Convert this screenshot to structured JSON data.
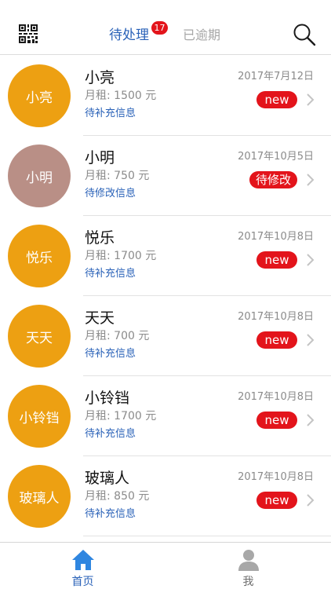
{
  "header": {
    "tabs": [
      {
        "label": "待处理",
        "badge": "17",
        "active": true
      },
      {
        "label": "已逾期",
        "active": false
      }
    ],
    "icons": {
      "left": "qr-code-icon",
      "right": "search-icon"
    }
  },
  "colors": {
    "accent": "#2a62b8",
    "badge_red": "#e3141b",
    "avatar_orange": "#eda012",
    "avatar_brown": "#b98f86"
  },
  "items": [
    {
      "avatar": "小亮",
      "avatar_color": "#eda012",
      "name": "小亮",
      "rent": "月租: 1500 元",
      "status": "待补充信息",
      "date": "2017年7月12日",
      "tag": "new"
    },
    {
      "avatar": "小明",
      "avatar_color": "#b98f86",
      "name": "小明",
      "rent": "月租: 750 元",
      "status": "待修改信息",
      "date": "2017年10月5日",
      "tag": "待修改"
    },
    {
      "avatar": "悦乐",
      "avatar_color": "#eda012",
      "name": "悦乐",
      "rent": "月租: 1700 元",
      "status": "待补充信息",
      "date": "2017年10月8日",
      "tag": "new"
    },
    {
      "avatar": "天天",
      "avatar_color": "#eda012",
      "name": "天天",
      "rent": "月租: 700 元",
      "status": "待补充信息",
      "date": "2017年10月8日",
      "tag": "new"
    },
    {
      "avatar": "小铃铛",
      "avatar_color": "#eda012",
      "name": "小铃铛",
      "rent": "月租: 1700 元",
      "status": "待补充信息",
      "date": "2017年10月8日",
      "tag": "new"
    },
    {
      "avatar": "玻璃人",
      "avatar_color": "#eda012",
      "name": "玻璃人",
      "rent": "月租: 850 元",
      "status": "待补充信息",
      "date": "2017年10月8日",
      "tag": "new"
    }
  ],
  "tabbar": {
    "home_label": "首页",
    "me_label": "我",
    "icons": {
      "home": "home-icon",
      "me": "user-icon"
    }
  }
}
